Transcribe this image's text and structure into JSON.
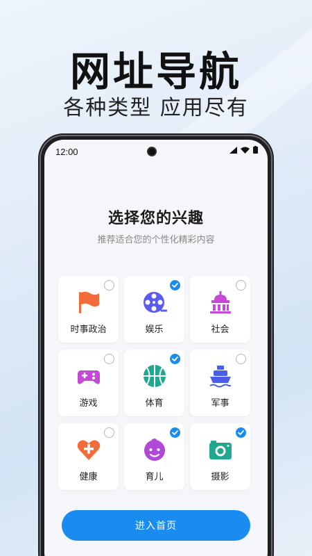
{
  "banner": {
    "title": "网址导航",
    "subtitle": "各种类型 应用尽有"
  },
  "statusbar": {
    "time": "12:00"
  },
  "page": {
    "title": "选择您的兴趣",
    "subtitle": "推荐适合您的个性化精彩内容"
  },
  "interests": [
    {
      "label": "时事政治",
      "icon": "flag-icon",
      "selected": false,
      "color": "#f26b3a"
    },
    {
      "label": "娱乐",
      "icon": "film-reel-icon",
      "selected": true,
      "color": "#5b5bf0"
    },
    {
      "label": "社会",
      "icon": "building-icon",
      "selected": false,
      "color": "#c44ad6"
    },
    {
      "label": "游戏",
      "icon": "gamepad-icon",
      "selected": false,
      "color": "#c44ad6"
    },
    {
      "label": "体育",
      "icon": "basketball-icon",
      "selected": true,
      "color": "#1fa88f"
    },
    {
      "label": "军事",
      "icon": "ship-icon",
      "selected": false,
      "color": "#4b5ee8"
    },
    {
      "label": "健康",
      "icon": "heart-plus-icon",
      "selected": false,
      "color": "#f26b3a"
    },
    {
      "label": "育儿",
      "icon": "baby-face-icon",
      "selected": true,
      "color": "#b048d8"
    },
    {
      "label": "摄影",
      "icon": "camera-icon",
      "selected": true,
      "color": "#1fa88f"
    }
  ],
  "actions": {
    "enter_label": "进入首页",
    "accent": "#1a8cf0"
  }
}
